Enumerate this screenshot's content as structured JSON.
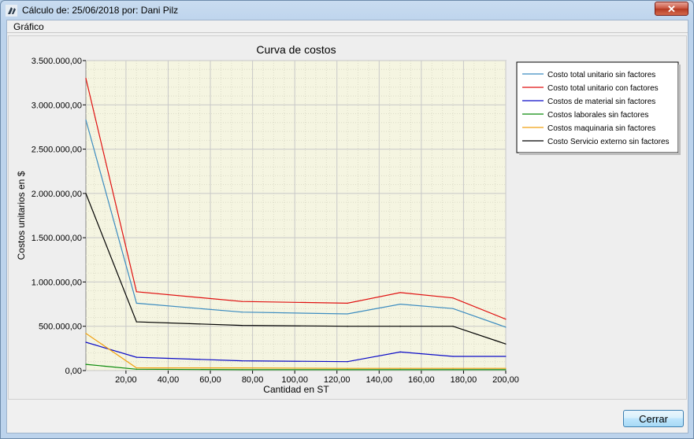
{
  "window": {
    "title": "Cálculo de: 25/06/2018 por: Dani Pilz",
    "close_label": "✕"
  },
  "group": {
    "label": "Gráfico"
  },
  "footer": {
    "close_button": "Cerrar"
  },
  "chart_data": {
    "type": "line",
    "title": "Curva de costos",
    "xlabel": "Cantidad en ST",
    "ylabel": "Costos unitarios en $",
    "xlim": [
      1,
      200
    ],
    "ylim": [
      0,
      3500000
    ],
    "x_ticks": [
      20,
      40,
      60,
      80,
      100,
      120,
      140,
      160,
      180,
      200
    ],
    "x_tick_labels": [
      "20,00",
      "40,00",
      "60,00",
      "80,00",
      "100,00",
      "120,00",
      "140,00",
      "160,00",
      "180,00",
      "200,00"
    ],
    "y_ticks": [
      0,
      500000,
      1000000,
      1500000,
      2000000,
      2500000,
      3000000,
      3500000
    ],
    "y_tick_labels": [
      "0,00",
      "500.000,00",
      "1.000.000,00",
      "1.500.000,00",
      "2.000.000,00",
      "2.500.000,00",
      "3.000.000,00",
      "3.500.000,00"
    ],
    "grid": true,
    "plot_background": "#f5f5e1",
    "legend_position": "right",
    "x": [
      1,
      25,
      75,
      125,
      150,
      175,
      200
    ],
    "series": [
      {
        "name": "Costo total unitario sin factores",
        "color": "#3c8cc0",
        "values": [
          2830000,
          760000,
          660000,
          640000,
          750000,
          700000,
          490000
        ]
      },
      {
        "name": "Costo total unitario con factores",
        "color": "#e01010",
        "values": [
          3300000,
          890000,
          780000,
          760000,
          880000,
          820000,
          580000
        ]
      },
      {
        "name": "Costos de material sin factores",
        "color": "#0a0ac8",
        "values": [
          320000,
          150000,
          110000,
          100000,
          210000,
          160000,
          160000
        ]
      },
      {
        "name": "Costos laborales sin factores",
        "color": "#0a8a0a",
        "values": [
          70000,
          15000,
          10000,
          10000,
          10000,
          10000,
          10000
        ]
      },
      {
        "name": "Costos maquinaria sin factores",
        "color": "#f0a010",
        "values": [
          420000,
          30000,
          30000,
          25000,
          25000,
          25000,
          25000
        ]
      },
      {
        "name": "Costo Servicio externo sin factores",
        "color": "#000000",
        "values": [
          2000000,
          550000,
          510000,
          500000,
          500000,
          500000,
          300000
        ]
      }
    ]
  }
}
